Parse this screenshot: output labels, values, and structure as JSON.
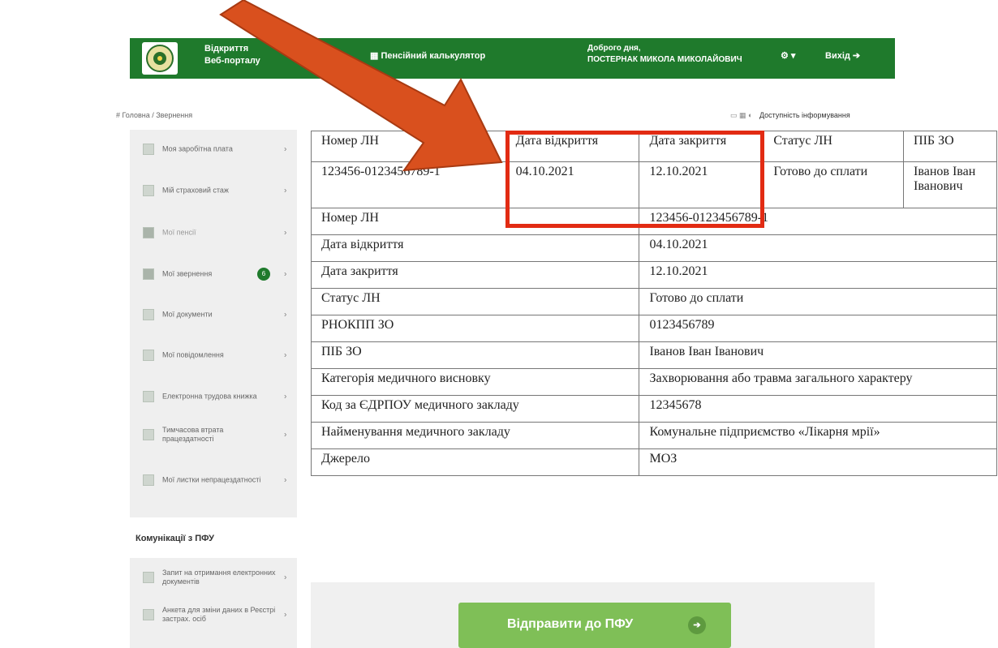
{
  "header": {
    "portal_title": "Відкриття\nВеб-порталу",
    "calculator": "▦ Пенсійний калькулятор",
    "greeting_line1": "Доброго дня,",
    "greeting_line2": "ПОСТЕРНАК МИКОЛА МИКОЛАЙОВИЧ",
    "settings": "⚙ ▾",
    "logout": "Вихід ➔"
  },
  "breadcrumb": "# Головна / Звернення",
  "accessibility": {
    "icons": "▭ ▦ ◐",
    "label": "Доступність інформування"
  },
  "sidebar": {
    "items": [
      {
        "label": "Моя заробітна плата"
      },
      {
        "label": "Мій страховий стаж"
      },
      {
        "label": "Мої пенсії"
      },
      {
        "label": "Мої звернення",
        "badge": "6"
      },
      {
        "label": "Мої документи"
      },
      {
        "label": "Мої повідомлення"
      },
      {
        "label": "Електронна трудова книжка"
      },
      {
        "label": "Тимчасова втрата працездатності"
      },
      {
        "label": "Мої листки непрацездатності"
      }
    ],
    "section_title": "Комунікації з ПФУ",
    "section_items": [
      {
        "label": "Запит на отримання електронних документів"
      },
      {
        "label": "Анкета для зміни даних в Реєстрі застрах. осіб"
      }
    ],
    "chevron": "›"
  },
  "table": {
    "headers": [
      "Номер ЛН",
      "Дата відкриття",
      "Дата закриття",
      "Статус ЛН",
      "ПІБ ЗО"
    ],
    "first_row": [
      "123456-0123456789-1",
      "04.10.2021",
      "12.10.2021",
      "Готово до сплати",
      "Іванов Іван Іванович"
    ],
    "details": [
      {
        "label": "Номер ЛН",
        "value": "123456-0123456789-1"
      },
      {
        "label": "Дата відкриття",
        "value": "04.10.2021"
      },
      {
        "label": "Дата закриття",
        "value": "12.10.2021"
      },
      {
        "label": "Статус ЛН",
        "value": "Готово до сплати"
      },
      {
        "label": "РНОКПП ЗО",
        "value": "0123456789"
      },
      {
        "label": "ПІБ ЗО",
        "value": "Іванов Іван Іванович"
      },
      {
        "label": "Категорія медичного висновку",
        "value": "Захворювання або травма загального характеру"
      },
      {
        "label": "Код за ЄДРПОУ медичного закладу",
        "value": "12345678"
      },
      {
        "label": "Найменування медичного закладу",
        "value": "Комунальне підприємство «Лікарня мрії»"
      },
      {
        "label": "Джерело",
        "value": "МОЗ"
      }
    ]
  },
  "send_button": {
    "label": "Відправити до ПФУ",
    "icon": "➔"
  },
  "colors": {
    "header_green": "#1f7a2c",
    "button_green": "#7fbf57",
    "annotation_red": "#e22b13",
    "arrow_fill": "#d9501e"
  }
}
